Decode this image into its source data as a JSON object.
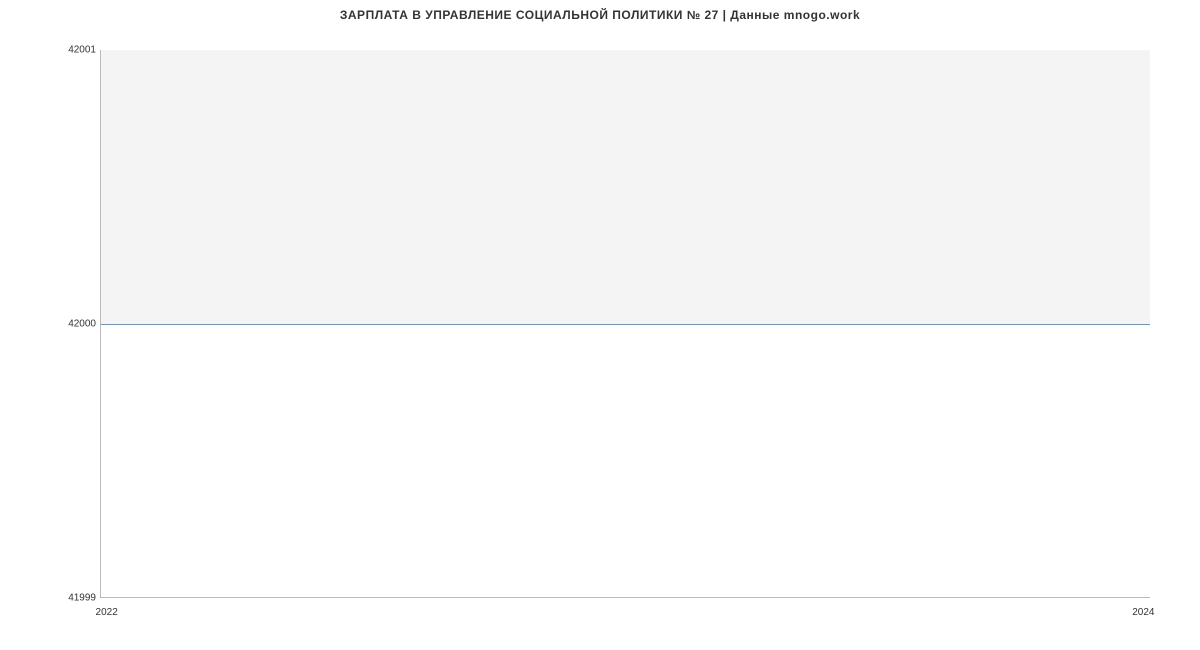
{
  "chart_data": {
    "type": "line",
    "title": "ЗАРПЛАТА В УПРАВЛЕНИЕ СОЦИАЛЬНОЙ ПОЛИТИКИ № 27 | Данные mnogo.work",
    "x": [
      2022,
      2024
    ],
    "values": [
      42000,
      42000
    ],
    "xlabel": "",
    "ylabel": "",
    "xlim": [
      2022,
      2024
    ],
    "ylim": [
      41999,
      42001
    ],
    "x_ticks": [
      "2022",
      "2024"
    ],
    "y_ticks": [
      "41999",
      "42000",
      "42001"
    ]
  }
}
